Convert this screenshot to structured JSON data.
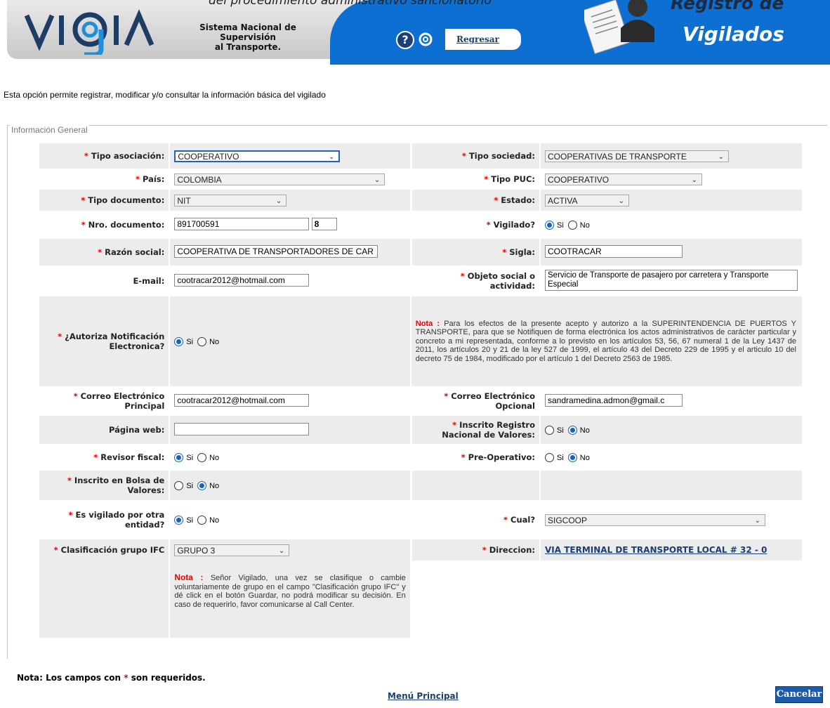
{
  "header": {
    "top_caption": "del procedimiento administrativo sancionatorio",
    "logo_text": "VIGIA",
    "subtitle_line1": "Sistema Nacional de Supervisión",
    "subtitle_line2": "al Transporte.",
    "help_icon": "question-circle-icon",
    "help_glyph": "?",
    "back_label": "Regresar",
    "title_line1": "Registro de",
    "title_line2": "Vigilados",
    "colors": {
      "blue": "#0d6fd1",
      "gray": "#c8c8c8",
      "navy": "#1c3e6e"
    }
  },
  "intro": "Esta opción permite registrar, modificar y/o consultar la información básica del vigilado",
  "section_legend": "Información General",
  "required_mark": "*",
  "form": {
    "tipo_asociacion": {
      "label": "Tipo asociación:",
      "value": "COOPERATIVO"
    },
    "tipo_sociedad": {
      "label": "Tipo sociedad:",
      "value": "COOPERATIVAS DE TRANSPORTE"
    },
    "pais": {
      "label": "País:",
      "value": "COLOMBIA"
    },
    "tipo_puc": {
      "label": "Tipo PUC:",
      "value": "COOPERATIVO"
    },
    "tipo_documento": {
      "label": "Tipo documento:",
      "value": "NIT"
    },
    "estado": {
      "label": "Estado:",
      "value": "ACTIVA"
    },
    "nro_documento": {
      "label": "Nro. documento:",
      "value": "891700591",
      "dv": "8"
    },
    "vigilado": {
      "label": "Vigilado?",
      "yes": "Si",
      "no": "No",
      "selected": "Si"
    },
    "razon_social": {
      "label": "Razón social:",
      "value": "COOPERATIVA DE TRANSPORTADORES DE CAR"
    },
    "sigla": {
      "label": "Sigla:",
      "value": "COOTRACAR"
    },
    "email": {
      "label": "E-mail:",
      "value": "cootracar2012@hotmail.com"
    },
    "objeto_social": {
      "label_line1": "Objeto social o",
      "label_line2": "actividad:",
      "value": "Servicio de Transporte de pasajero por carretera y Transporte Especial"
    },
    "autoriza": {
      "label_line1": "¿Autoriza Notificación",
      "label_line2": "Electronica?",
      "yes": "Si",
      "no": "No",
      "selected": "Si"
    },
    "nota_autoriza": {
      "prefix": "Nota :",
      "text": "Para los efectos de la presente acepto y autorizo a la SUPERINTENDENCIA DE PUERTOS Y TRANSPORTE, para que se Notifiquen de forma electrónica los actos administrativos de carácter particular y concreto a mi representada, conforme a lo previsto en los artículos 53, 56, 67 numeral 1 de la Ley 1437 de 2011, los artículos 20 y 21 de la ley 527 de 1999, el artículo 43 del Decreto 229 de 1995 y el articulo 10 del decreto 75 de 1984, modificado por el artículo 1 del Decreto 2563 de 1985."
    },
    "correo_principal": {
      "label_line1": "Correo Electrónico",
      "label_line2": "Principal",
      "value": "cootracar2012@hotmail.com"
    },
    "correo_opcional": {
      "label_line1": "Correo Electrónico",
      "label_line2": "Opcional",
      "value": "sandramedina.admon@gmail.c"
    },
    "pagina_web": {
      "label": "Página web:",
      "value": ""
    },
    "inscrito_rnv": {
      "label_line1": "Inscrito Registro",
      "label_line2": "Nacional de Valores:",
      "yes": "Si",
      "no": "No",
      "selected": "No"
    },
    "revisor_fiscal": {
      "label": "Revisor fiscal:",
      "yes": "Si",
      "no": "No",
      "selected": "Si"
    },
    "pre_operativo": {
      "label": "Pre-Operativo:",
      "yes": "Si",
      "no": "No",
      "selected": "No"
    },
    "inscrito_bolsa": {
      "label_line1": "Inscrito en Bolsa de",
      "label_line2": "Valores:",
      "yes": "Si",
      "no": "No",
      "selected": "No"
    },
    "vigilado_otra": {
      "label_line1": "Es vigilado por otra",
      "label_line2": "entidad?",
      "yes": "Si",
      "no": "No",
      "selected": "Si"
    },
    "cual": {
      "label": "Cual?",
      "value": "SIGCOOP"
    },
    "clasificacion_ifc": {
      "label": "Clasificación grupo IFC",
      "value": "GRUPO 3"
    },
    "direccion": {
      "label": "Direccion:",
      "value": "VIA TERMINAL DE TRANSPORTE LOCAL # 32 - 0"
    },
    "nota_ifc": {
      "prefix": "Nota :",
      "text": "Señor Vigilado, una vez se clasifique o cambie voluntariamente de grupo en el campo \"Clasificación grupo IFC\" y dé click en el botón Guardar, no podrá modificar su decisión. En caso de requerirlo, favor comunicarse al Call Center."
    }
  },
  "footer": {
    "required_note_prefix": "Nota: Los campos con",
    "required_note_suffix": "son requeridos.",
    "menu_label": "Menú Principal",
    "cancel_label": "Cancelar"
  }
}
